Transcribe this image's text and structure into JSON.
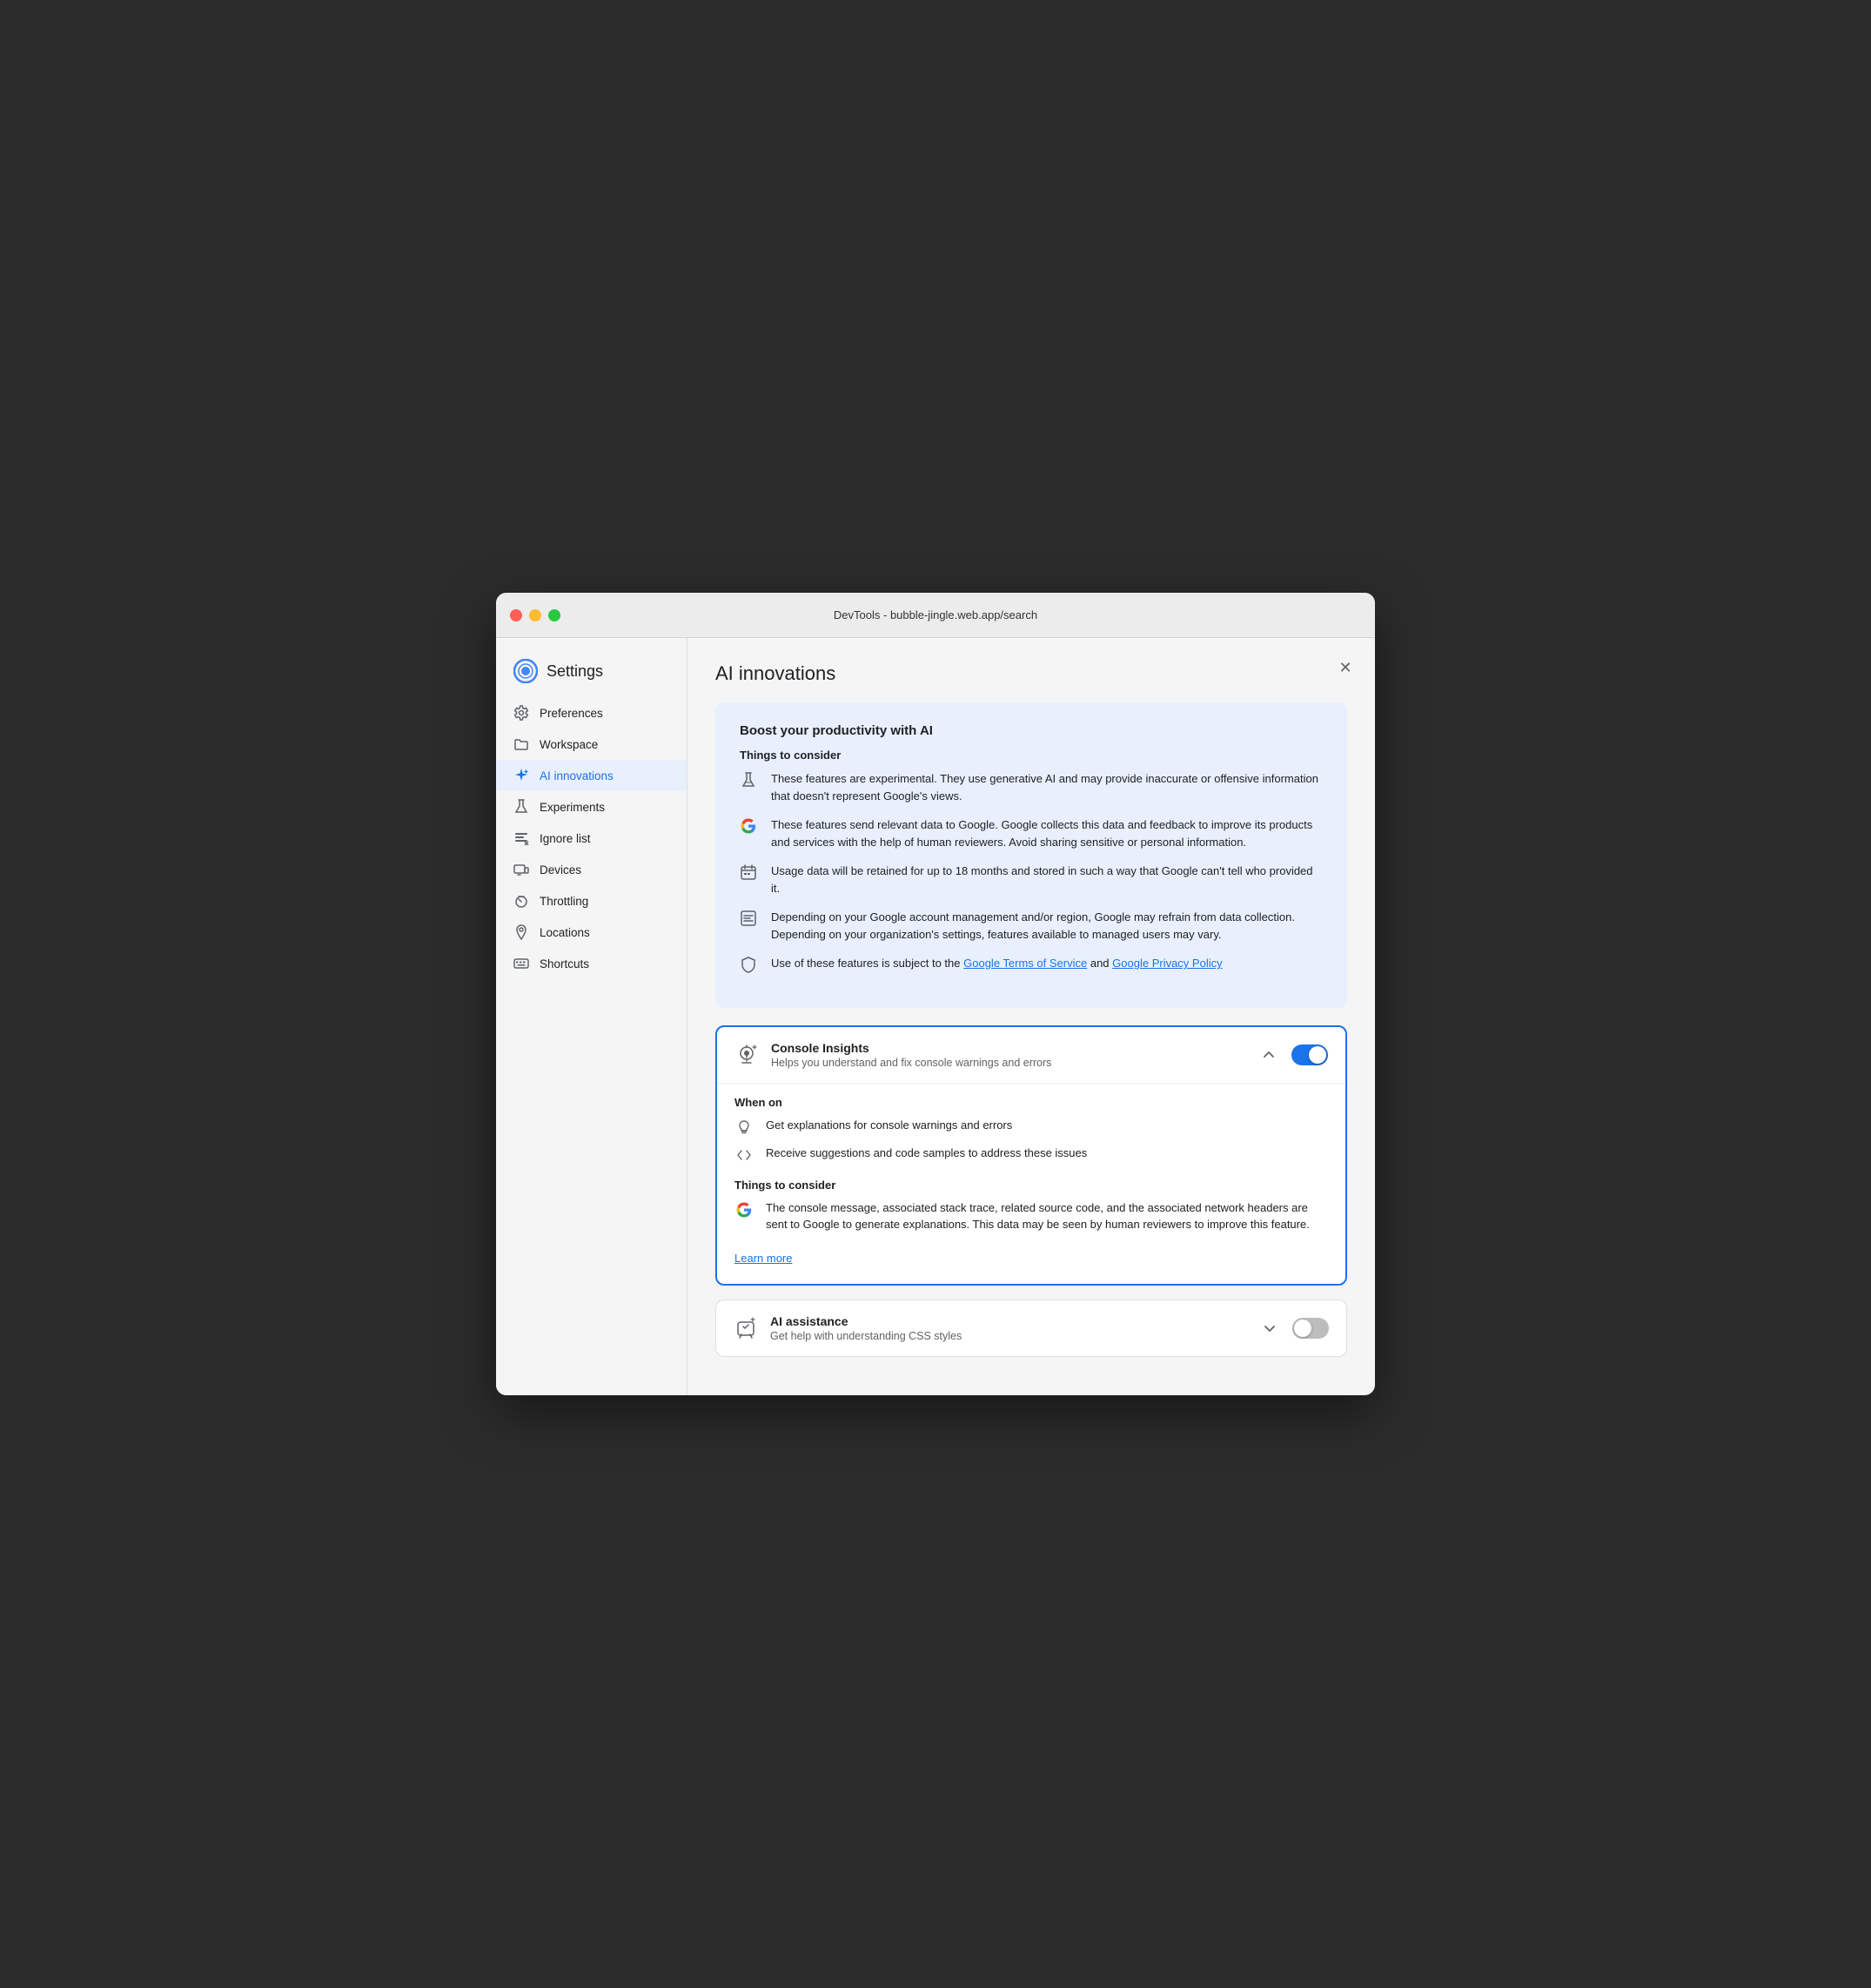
{
  "window": {
    "title": "DevTools - bubble-jingle.web.app/search"
  },
  "sidebar": {
    "title": "Settings",
    "items": [
      {
        "id": "preferences",
        "label": "Preferences",
        "icon": "gear"
      },
      {
        "id": "workspace",
        "label": "Workspace",
        "icon": "folder"
      },
      {
        "id": "ai-innovations",
        "label": "AI innovations",
        "icon": "sparkle",
        "active": true
      },
      {
        "id": "experiments",
        "label": "Experiments",
        "icon": "flask"
      },
      {
        "id": "ignore-list",
        "label": "Ignore list",
        "icon": "ignore"
      },
      {
        "id": "devices",
        "label": "Devices",
        "icon": "devices"
      },
      {
        "id": "throttling",
        "label": "Throttling",
        "icon": "throttle"
      },
      {
        "id": "locations",
        "label": "Locations",
        "icon": "pin"
      },
      {
        "id": "shortcuts",
        "label": "Shortcuts",
        "icon": "keyboard"
      }
    ]
  },
  "main": {
    "title": "AI innovations",
    "close_label": "×",
    "info_box": {
      "title": "Boost your productivity with AI",
      "things_to_consider": "Things to consider",
      "items": [
        {
          "icon": "experiment",
          "text": "These features are experimental. They use generative AI and may provide inaccurate or offensive information that doesn't represent Google's views."
        },
        {
          "icon": "google-g",
          "text": "These features send relevant data to Google. Google collects this data and feedback to improve its products and services with the help of human reviewers. Avoid sharing sensitive or personal information."
        },
        {
          "icon": "calendar",
          "text": "Usage data will be retained for up to 18 months and stored in such a way that Google can't tell who provided it."
        },
        {
          "icon": "list",
          "text": "Depending on your Google account management and/or region, Google may refrain from data collection. Depending on your organization's settings, features available to managed users may vary."
        },
        {
          "icon": "shield",
          "text_before": "Use of these features is subject to the ",
          "link1_text": "Google Terms of Service",
          "link1_href": "#",
          "text_middle": " and ",
          "link2_text": "Google Privacy Policy",
          "link2_href": "#",
          "text_after": ""
        }
      ]
    },
    "console_insights": {
      "title": "Console Insights",
      "subtitle": "Helps you understand and fix console warnings and errors",
      "toggle_on": true,
      "expanded": true,
      "when_on_title": "When on",
      "when_on_items": [
        {
          "icon": "bulb",
          "text": "Get explanations for console warnings and errors"
        },
        {
          "icon": "code-brackets",
          "text": "Receive suggestions and code samples to address these issues"
        }
      ],
      "things_title": "Things to consider",
      "things_items": [
        {
          "icon": "google-g",
          "text": "The console message, associated stack trace, related source code, and the associated network headers are sent to Google to generate explanations. This data may be seen by human reviewers to improve this feature."
        }
      ],
      "learn_more": "Learn more"
    },
    "ai_assistance": {
      "title": "AI assistance",
      "subtitle": "Get help with understanding CSS styles",
      "toggle_on": false,
      "expanded": false
    }
  }
}
